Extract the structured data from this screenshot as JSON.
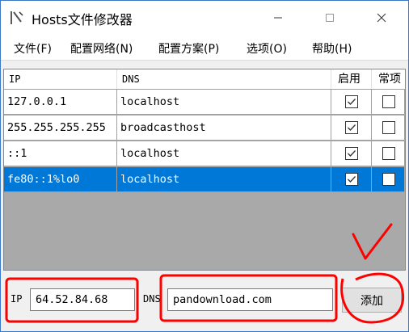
{
  "window": {
    "title": "Hosts文件修改器"
  },
  "menu": [
    {
      "label": "文件(F)"
    },
    {
      "label": "配置网络(N)"
    },
    {
      "label": "配置方案(P)"
    },
    {
      "label": "选项(O)"
    },
    {
      "label": "帮助(H)"
    }
  ],
  "table": {
    "headers": {
      "ip": "IP",
      "dns": "DNS",
      "enabled": "启用",
      "common": "常项"
    },
    "rows": [
      {
        "ip": "127.0.0.1",
        "dns": "localhost",
        "enabled": true,
        "common": false,
        "selected": false
      },
      {
        "ip": "255.255.255.255",
        "dns": "broadcasthost",
        "enabled": true,
        "common": false,
        "selected": false
      },
      {
        "ip": "::1",
        "dns": "localhost",
        "enabled": true,
        "common": false,
        "selected": false
      },
      {
        "ip": "fe80::1%lo0",
        "dns": "localhost",
        "enabled": true,
        "common": false,
        "selected": true
      }
    ]
  },
  "form": {
    "ip_label": "IP",
    "ip_value": "64.52.84.68",
    "dns_label": "DNS",
    "dns_value": "pandownload.com",
    "add_button": "添加"
  },
  "colors": {
    "selection": "#0078d7",
    "annotation": "#ff0000"
  }
}
